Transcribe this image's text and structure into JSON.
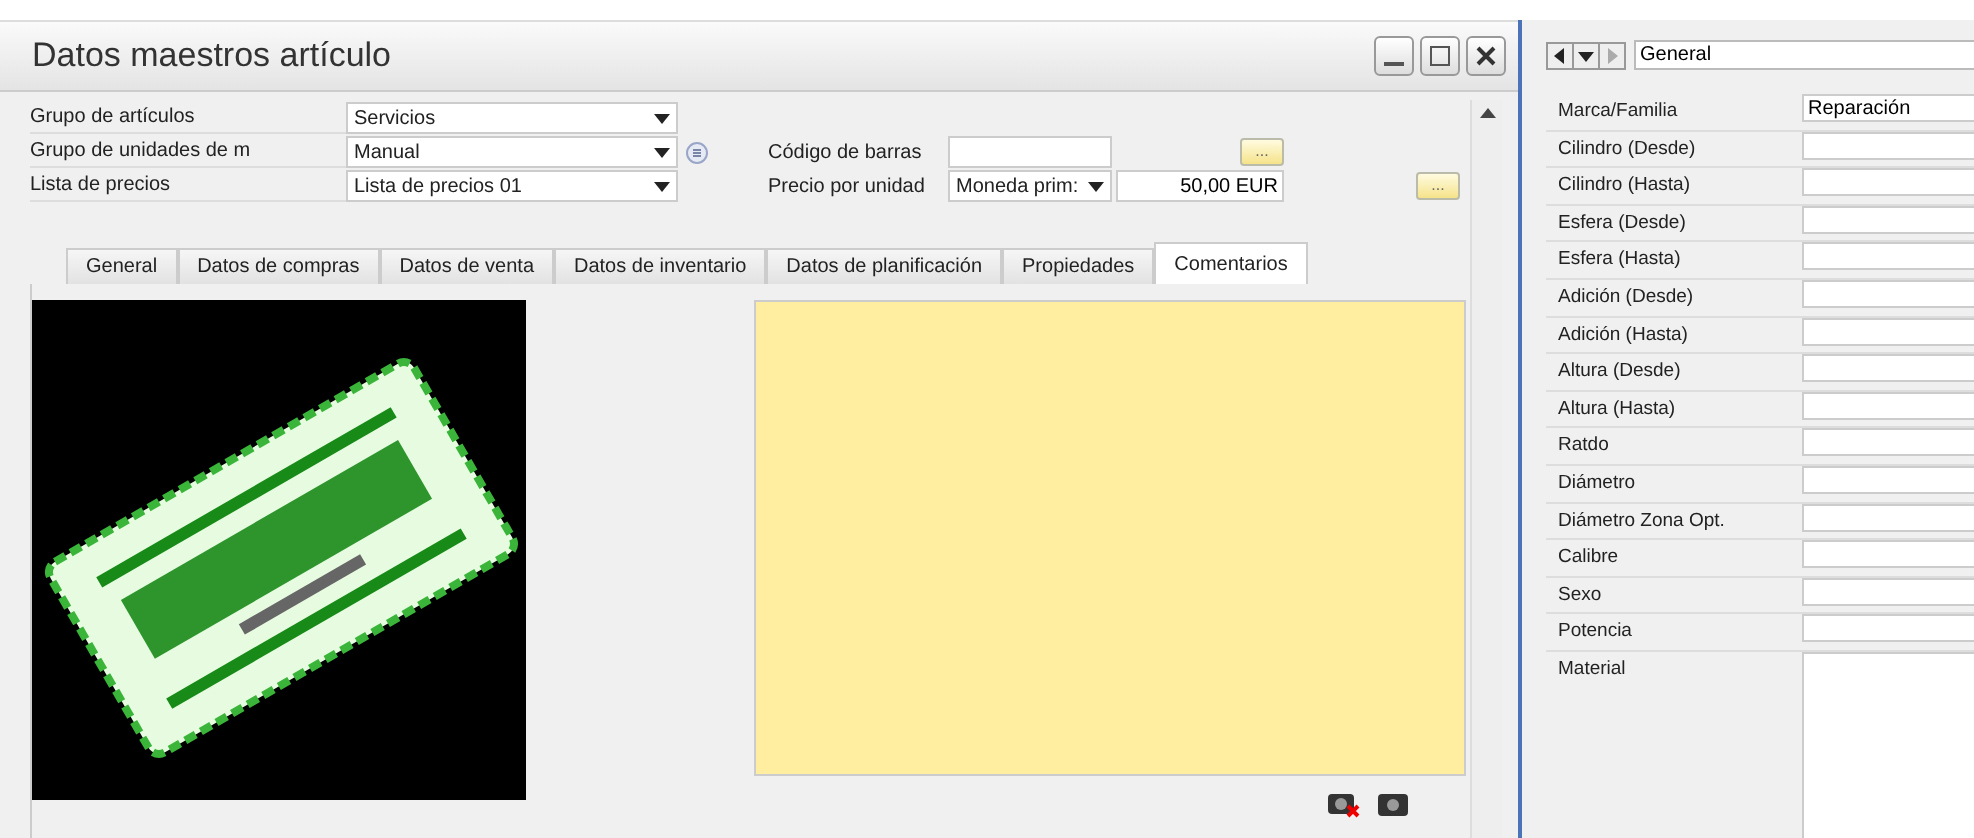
{
  "window": {
    "title": "Datos maestros artículo"
  },
  "form": {
    "rows": [
      {
        "label": "Grupo de artículos",
        "value": "Servicios",
        "info": false
      },
      {
        "label": "Grupo de unidades de m",
        "value": "Manual",
        "info": true
      },
      {
        "label": "Lista de precios",
        "value": "Lista de precios 01",
        "info": false
      }
    ],
    "barcode": {
      "label": "Código de barras",
      "button": "..."
    },
    "price": {
      "label": "Precio por unidad",
      "currency": "Moneda prim:",
      "amount": "50,00 EUR",
      "button": "..."
    }
  },
  "tabs": [
    {
      "label": "General",
      "selected": false
    },
    {
      "label": "Datos de compras",
      "selected": false
    },
    {
      "label": "Datos de venta",
      "selected": false
    },
    {
      "label": "Datos de inventario",
      "selected": false
    },
    {
      "label": "Datos de planificación",
      "selected": false
    },
    {
      "label": "Propiedades",
      "selected": false
    },
    {
      "label": "Comentarios",
      "selected": true
    }
  ],
  "side_panel": {
    "category": "General",
    "fields": [
      {
        "label": "Marca/Familia",
        "value": "Reparación",
        "kind": "line"
      },
      {
        "label": "Cilindro (Desde)",
        "kind": "line"
      },
      {
        "label": "Cilindro (Hasta)",
        "kind": "line"
      },
      {
        "label": "Esfera (Desde)",
        "kind": "line"
      },
      {
        "label": "Esfera (Hasta)",
        "kind": "line"
      },
      {
        "label": "Adición (Desde)",
        "kind": "line"
      },
      {
        "label": "Adición (Hasta)",
        "kind": "line"
      },
      {
        "label": "Altura (Desde)",
        "kind": "line"
      },
      {
        "label": "Altura (Hasta)",
        "kind": "line"
      },
      {
        "label": "Ratdo",
        "kind": "line"
      },
      {
        "label": "Diámetro",
        "kind": "line"
      },
      {
        "label": "Diámetro Zona Opt.",
        "kind": "line"
      },
      {
        "label": "Calibre",
        "kind": "line"
      },
      {
        "label": "Sexo",
        "kind": "line"
      },
      {
        "label": "Potencia",
        "kind": "line"
      },
      {
        "label": "Material",
        "kind": "area"
      }
    ]
  }
}
